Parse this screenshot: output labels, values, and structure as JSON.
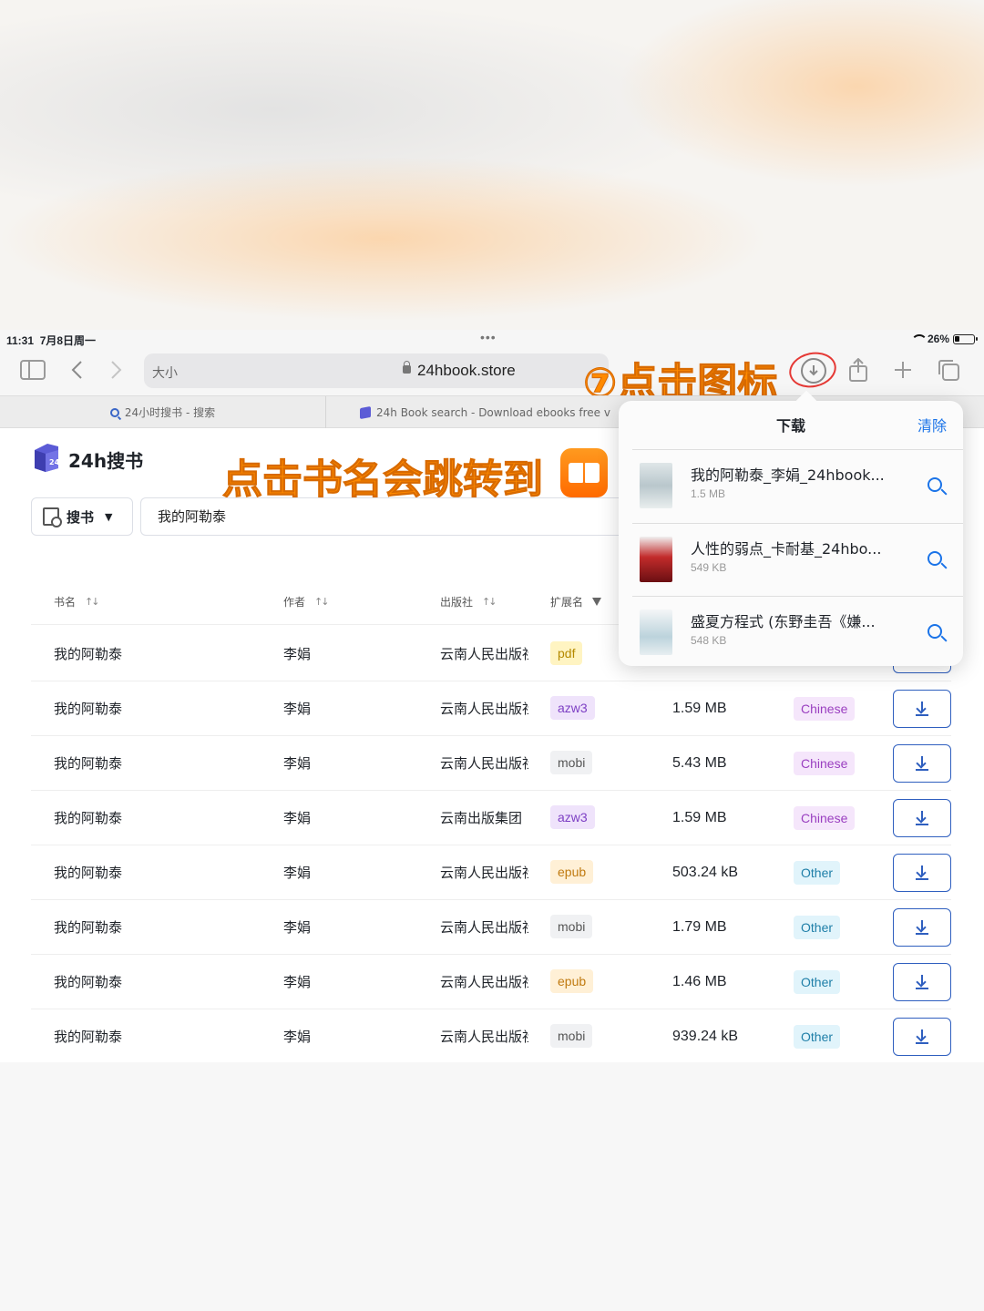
{
  "status": {
    "time": "11:31",
    "date": "7月8日周一",
    "dots": "•••",
    "battery": "26%",
    "battery_level": 0.26
  },
  "toolbar": {
    "reader": "大小",
    "url": "24hbook.store"
  },
  "annotations": {
    "download_hint": "⑦点击图标",
    "book_hint": "点击书名会跳转到"
  },
  "tabs": [
    {
      "label": "24小时搜书 - 搜索"
    },
    {
      "label": "24h Book search - Download ebooks free v"
    }
  ],
  "site": {
    "title": "24h搜书",
    "search_type": "搜书",
    "search_query": "我的阿勒泰"
  },
  "columns": {
    "title": "书名",
    "author": "作者",
    "publisher": "出版社",
    "ext": "扩展名"
  },
  "rows": [
    {
      "title": "我的阿勒泰",
      "author": "李娟",
      "publisher": "云南人民出版社",
      "ext": "pdf",
      "size": "",
      "lang": ""
    },
    {
      "title": "我的阿勒泰",
      "author": "李娟",
      "publisher": "云南人民出版社",
      "ext": "azw3",
      "size": "1.59 MB",
      "lang": "Chinese"
    },
    {
      "title": "我的阿勒泰",
      "author": "李娟",
      "publisher": "云南人民出版社",
      "ext": "mobi",
      "size": "5.43 MB",
      "lang": "Chinese"
    },
    {
      "title": "我的阿勒泰",
      "author": "李娟",
      "publisher": "云南出版集团",
      "ext": "azw3",
      "size": "1.59 MB",
      "lang": "Chinese"
    },
    {
      "title": "我的阿勒泰",
      "author": "李娟",
      "publisher": "云南人民出版社",
      "ext": "epub",
      "size": "503.24 kB",
      "lang": "Other"
    },
    {
      "title": "我的阿勒泰",
      "author": "李娟",
      "publisher": "云南人民出版社",
      "ext": "mobi",
      "size": "1.79 MB",
      "lang": "Other"
    },
    {
      "title": "我的阿勒泰",
      "author": "李娟",
      "publisher": "云南人民出版社",
      "ext": "epub",
      "size": "1.46 MB",
      "lang": "Other"
    },
    {
      "title": "我的阿勒泰",
      "author": "李娟",
      "publisher": "云南人民出版社",
      "ext": "mobi",
      "size": "939.24 kB",
      "lang": "Other"
    }
  ],
  "downloads": {
    "title": "下载",
    "clear": "清除",
    "items": [
      {
        "name": "我的阿勒泰_李娟_24hbook...",
        "size": "1.5 MB"
      },
      {
        "name": "人性的弱点_卡耐基_24hbo...",
        "size": "549 KB"
      },
      {
        "name": "盛夏方程式 (东野圭吾《嫌...",
        "size": "548 KB"
      }
    ]
  },
  "colors": {
    "accent": "#2f5fbf",
    "annotation": "#ff8a00",
    "ext_pdf_bg": "#fff4c2",
    "ext_pdf_fg": "#b58a00",
    "ext_azw3_bg": "#efe3fb",
    "ext_azw3_fg": "#7d3fc4",
    "ext_mobi_bg": "#f0f1f3",
    "ext_mobi_fg": "#555555",
    "ext_epub_bg": "#fff0d6",
    "ext_epub_fg": "#c07a10",
    "lang_chinese_bg": "#f5e6fb",
    "lang_chinese_fg": "#9a3fc0",
    "lang_other_bg": "#e1f4fb",
    "lang_other_fg": "#1f7fa8"
  }
}
